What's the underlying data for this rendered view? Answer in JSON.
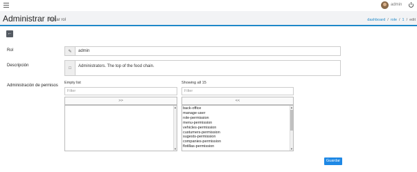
{
  "topbar": {
    "user_name": "admin",
    "icons": [
      "hamburger-icon",
      "avatar",
      "power-icon"
    ]
  },
  "header": {
    "title": "Administrar rol",
    "subtitle": "Editar rol",
    "breadcrumb": [
      "dashboard",
      "/",
      "role",
      "/",
      "1",
      "/",
      "edit"
    ]
  },
  "form": {
    "rol_label": "Rol",
    "rol_value": "admin",
    "descripcion_label": "Descripción",
    "descripcion_value": "Administrators. The top of the food chain.",
    "permisos_label": "Administración de permisos"
  },
  "dual_list": {
    "left": {
      "caption": "Empty list",
      "filter_placeholder": "Filter",
      "move_label": ">>",
      "items": []
    },
    "right": {
      "caption": "Showing all 15",
      "filter_placeholder": "Filter",
      "move_label": "<<",
      "items": [
        "back-office",
        "manage-user",
        "role-permission",
        "menu-permission",
        "vehicles-permission",
        "custumers-permission",
        "sugests-permission",
        "companies-permission",
        "flotillas-permission"
      ]
    }
  },
  "actions": {
    "save_label": "Guardar"
  },
  "colors": {
    "accent": "#1e88c8",
    "button_primary": "#1e88e5",
    "back_button": "#555b63"
  }
}
